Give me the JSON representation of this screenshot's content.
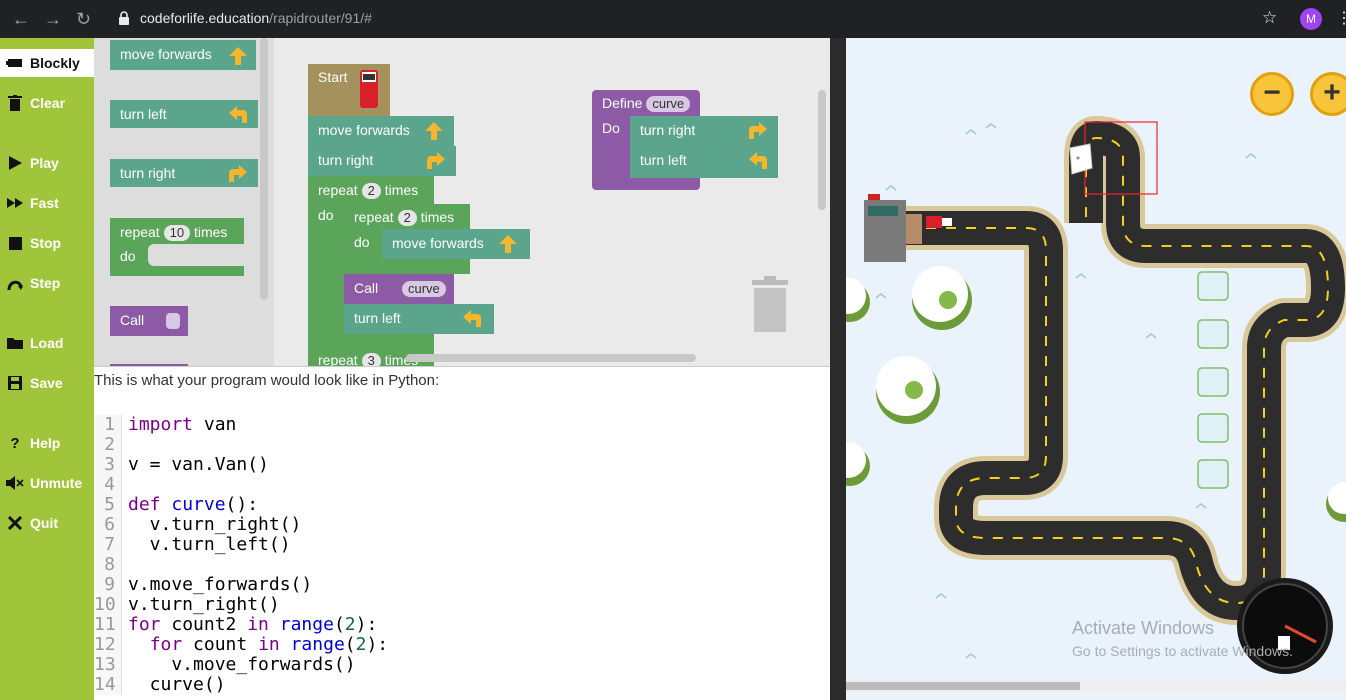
{
  "browser": {
    "url_host": "codeforlife.education",
    "url_path": "/rapidrouter/91/#",
    "profile_initial": "M"
  },
  "sidebar": {
    "items": [
      {
        "label": "Blockly",
        "icon": "blockly-icon"
      },
      {
        "label": "Clear",
        "icon": "trash-icon"
      },
      {
        "label": "Play",
        "icon": "play-icon"
      },
      {
        "label": "Fast",
        "icon": "fast-forward-icon"
      },
      {
        "label": "Stop",
        "icon": "stop-icon"
      },
      {
        "label": "Step",
        "icon": "step-icon"
      },
      {
        "label": "Load",
        "icon": "folder-icon"
      },
      {
        "label": "Save",
        "icon": "save-icon"
      },
      {
        "label": "Help",
        "icon": "help-icon"
      },
      {
        "label": "Unmute",
        "icon": "speaker-icon"
      },
      {
        "label": "Quit",
        "icon": "close-icon"
      }
    ]
  },
  "toolbox": {
    "move_forwards": "move forwards",
    "turn_left": "turn left",
    "turn_right": "turn right",
    "repeat": "repeat",
    "repeat_count": "10",
    "times": "times",
    "do": "do",
    "call": "Call"
  },
  "workspace": {
    "start": "Start",
    "move_forwards": "move forwards",
    "turn_right": "turn right",
    "turn_left": "turn left",
    "repeat": "repeat",
    "times": "times",
    "do": "do",
    "repeat_outer_count": "2",
    "repeat_inner_count": "2",
    "repeat_third_count": "3",
    "repeat_third_times": "times",
    "call": "Call",
    "call_name": "curve",
    "define": "Define",
    "define_name": "curve",
    "define_do": "Do"
  },
  "python": {
    "caption": "This is what your program would look like in Python:",
    "lines": [
      {
        "n": "1",
        "t": "import van"
      },
      {
        "n": "2",
        "t": ""
      },
      {
        "n": "3",
        "t": "v = van.Van()"
      },
      {
        "n": "4",
        "t": ""
      },
      {
        "n": "5",
        "t": "def curve():"
      },
      {
        "n": "6",
        "t": "  v.turn_right()"
      },
      {
        "n": "7",
        "t": "  v.turn_left()"
      },
      {
        "n": "8",
        "t": ""
      },
      {
        "n": "9",
        "t": "v.move_forwards()"
      },
      {
        "n": "10",
        "t": "v.turn_right()"
      },
      {
        "n": "11",
        "t": "for count2 in range(2):"
      },
      {
        "n": "12",
        "t": "  for count in range(2):"
      },
      {
        "n": "13",
        "t": "    v.move_forwards()"
      },
      {
        "n": "14",
        "t": "  curve()"
      }
    ]
  },
  "game": {
    "zoom_out": "−",
    "zoom_in": "+",
    "watermark_title": "Activate Windows",
    "watermark_sub": "Go to Settings to activate Windows."
  },
  "colors": {
    "sidebar": "#a0c53a",
    "action_block": "#5ba58c",
    "start_block": "#a5915b",
    "repeat_block": "#5ba55b",
    "procedure_block": "#8d5ba5",
    "road": "#2d2d2d",
    "road_edge": "#d9c89a",
    "snow": "#eaf3fb"
  }
}
